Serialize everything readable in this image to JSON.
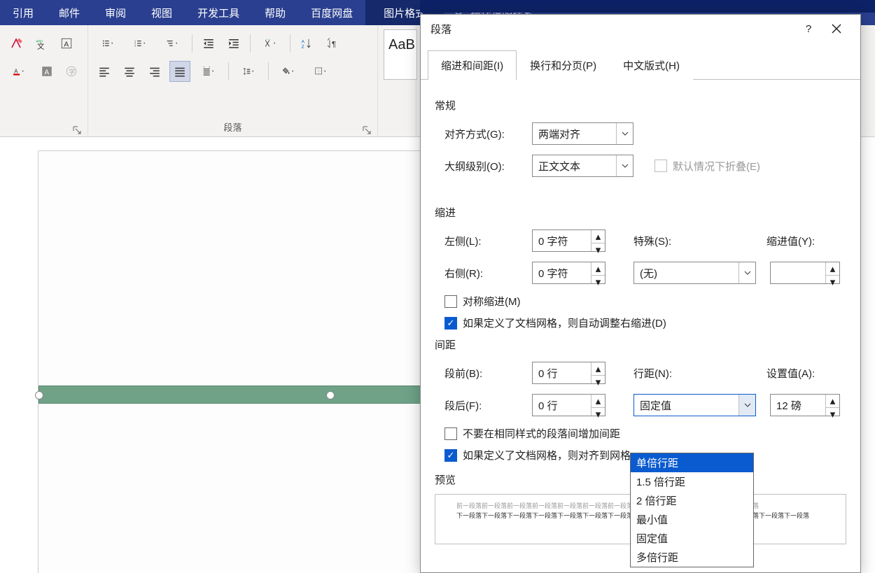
{
  "ribbon": {
    "tabs": [
      "引用",
      "邮件",
      "审阅",
      "视图",
      "开发工具",
      "帮助",
      "百度网盘"
    ],
    "context_tab": "图片格式",
    "search_placeholder": "操作说明搜索",
    "groups": {
      "font_label": "",
      "para_label": "段落",
      "styles_sample": "AaB"
    }
  },
  "dialog": {
    "title": "段落",
    "tabs": {
      "indent": "缩进和间距(I)",
      "pagebreak": "换行和分页(P)",
      "asian": "中文版式(H)"
    },
    "general": {
      "section": "常规",
      "align_label": "对齐方式(G):",
      "align_value": "两端对齐",
      "outline_label": "大纲级别(O):",
      "outline_value": "正文文本",
      "collapse_label": "默认情况下折叠(E)"
    },
    "indent": {
      "section": "缩进",
      "left_label": "左侧(L):",
      "left_value": "0 字符",
      "right_label": "右侧(R):",
      "right_value": "0 字符",
      "special_label": "特殊(S):",
      "special_value": "(无)",
      "indent_by_label": "缩进值(Y):",
      "indent_by_value": "",
      "mirror_label": "对称缩进(M)",
      "grid_label": "如果定义了文档网格，则自动调整右缩进(D)"
    },
    "spacing": {
      "section": "间距",
      "before_label": "段前(B):",
      "before_value": "0 行",
      "after_label": "段后(F):",
      "after_value": "0 行",
      "line_label": "行距(N):",
      "line_value": "固定值",
      "at_label": "设置值(A):",
      "at_value": "12 磅",
      "nosame_label": "不要在相同样式的段落间增加间距",
      "grid_label": "如果定义了文档网格，则对齐到网格",
      "options": [
        "单倍行距",
        "1.5 倍行距",
        "2 倍行距",
        "最小值",
        "固定值",
        "多倍行距"
      ]
    },
    "preview": {
      "label": "预览",
      "filler_light": "前一段落前一段落前一段落前一段落前一段落前一段落前一段落前一段落前一段落前一段落前一段落前一段落",
      "filler_dark": "下一段落下一段落下一段落下一段落下一段落下一段落下一段落下一段落下一段落下一段落下一段落下一段落下一段落下一段落"
    }
  }
}
